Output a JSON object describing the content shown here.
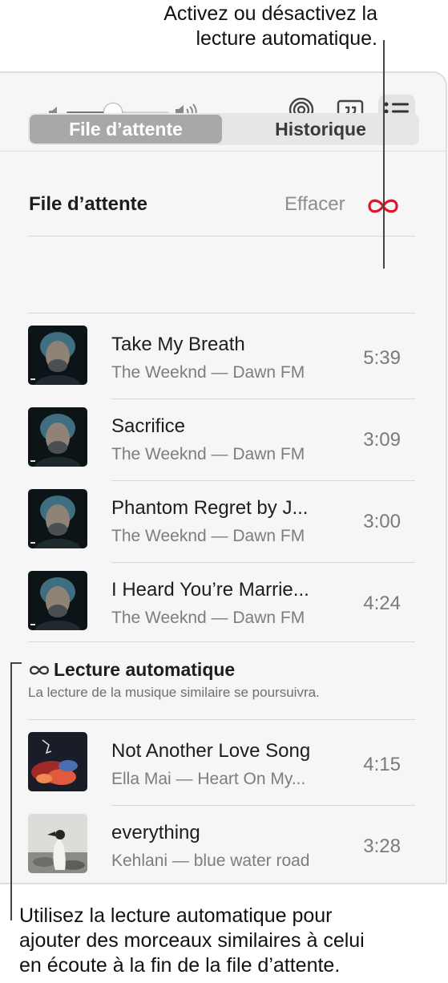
{
  "callouts": {
    "top_line1": "Activez ou désactivez la",
    "top_line2": "lecture automatique.",
    "bottom_line1": "Utilisez la lecture automatique pour",
    "bottom_line2": "ajouter des morceaux similaires à celui",
    "bottom_line3": "en écoute à la fin de la file d’attente."
  },
  "toolbar": {
    "volume_level": 0.45,
    "icons": [
      "speaker-low-icon",
      "speaker-high-icon",
      "airplay-icon",
      "lyrics-icon",
      "queue-list-icon"
    ]
  },
  "tabs": [
    {
      "label": "File d’attente",
      "selected": true
    },
    {
      "label": "Historique",
      "selected": false
    }
  ],
  "queue": {
    "heading": "File d’attente",
    "clear_label": "Effacer",
    "autoplay_icon": "infinity-icon",
    "autoplay_color": "#e0142c",
    "tracks": [
      {
        "title": "Take My Breath",
        "subtitle": "The Weeknd — Dawn FM",
        "duration": "5:39"
      },
      {
        "title": "Sacrifice",
        "subtitle": "The Weeknd — Dawn FM",
        "duration": "3:09"
      },
      {
        "title": "Phantom Regret by J...",
        "subtitle": "The Weeknd — Dawn FM",
        "duration": "3:00"
      },
      {
        "title": "I Heard You’re Marrie...",
        "subtitle": "The Weeknd — Dawn FM",
        "duration": "4:24"
      }
    ]
  },
  "autoplay": {
    "title": "Lecture automatique",
    "description": "La lecture de la musique similaire se poursuivra.",
    "tracks": [
      {
        "title": "Not Another Love Song",
        "subtitle": "Ella Mai — Heart On My...",
        "duration": "4:15"
      },
      {
        "title": "everything",
        "subtitle": "Kehlani — blue water road",
        "duration": "3:28"
      }
    ]
  }
}
